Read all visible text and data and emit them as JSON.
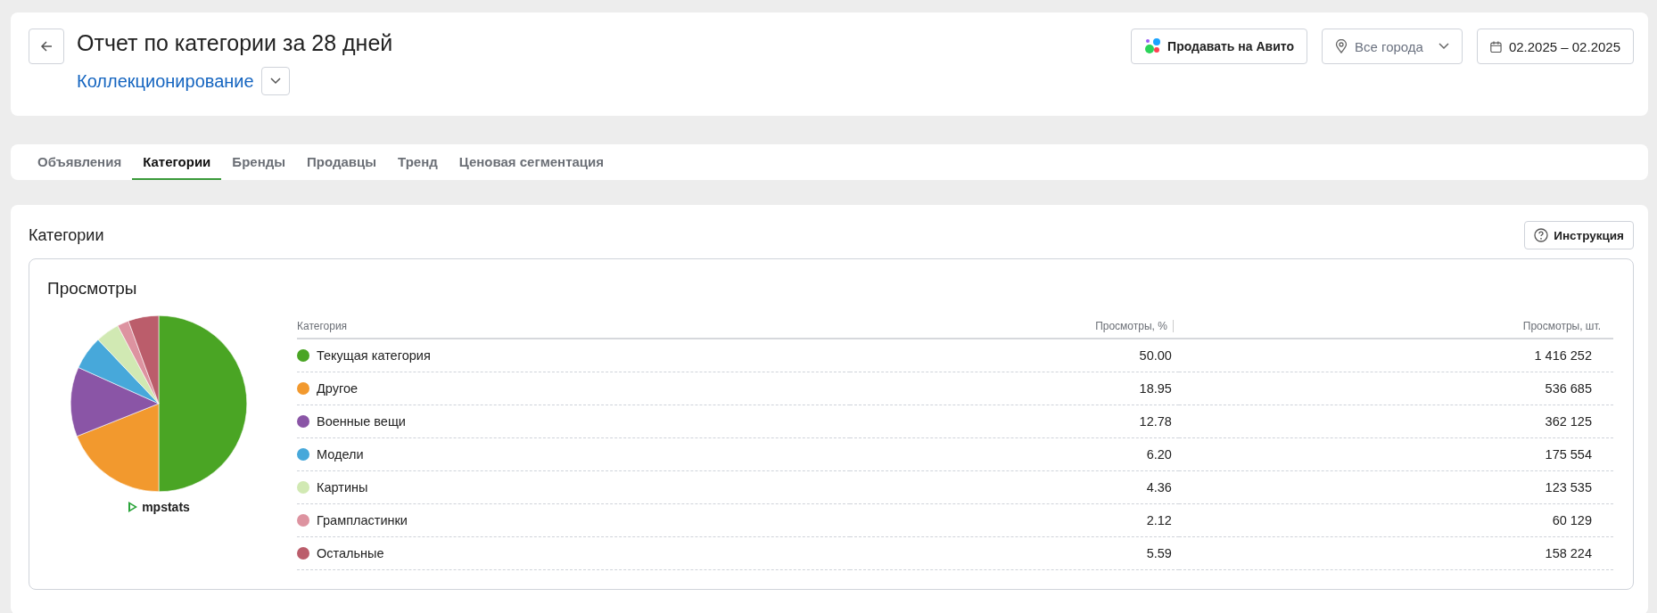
{
  "header": {
    "title": "Отчет по категории за 28 дней",
    "category": "Коллекционирование",
    "sell_button": "Продавать на Авито",
    "city_select": {
      "value": "Все города"
    },
    "date_range": "02.2025 – 02.2025"
  },
  "tabs": [
    {
      "label": "Объявления",
      "selected": false
    },
    {
      "label": "Категории",
      "selected": true
    },
    {
      "label": "Бренды",
      "selected": false
    },
    {
      "label": "Продавцы",
      "selected": false
    },
    {
      "label": "Тренд",
      "selected": false
    },
    {
      "label": "Ценовая сегментация",
      "selected": false
    }
  ],
  "section": {
    "title": "Категории",
    "help_button": "Инструкция"
  },
  "panel": {
    "chart_data": {
      "type": "pie",
      "title": "Просмотры",
      "series": [
        {
          "values": [
            50.0,
            18.95,
            12.78,
            6.2,
            4.36,
            2.12,
            5.59
          ]
        }
      ]
    },
    "watermark_logo": "mpstats",
    "table": {
      "columns": [
        "Категория",
        "Просмотры, %",
        "Просмотры, шт."
      ],
      "rows": [
        {
          "category": "Текущая категория",
          "color": "#4aa524",
          "percent": "50.00",
          "count": "1 416 252"
        },
        {
          "category": "Другое",
          "color": "#f2992e",
          "percent": "18.95",
          "count": "536 685"
        },
        {
          "category": "Военные вещи",
          "color": "#8a55a6",
          "percent": "12.78",
          "count": "362 125"
        },
        {
          "category": "Модели",
          "color": "#47a8da",
          "percent": "6.20",
          "count": "175 554"
        },
        {
          "category": "Картины",
          "color": "#d1e9b3",
          "percent": "4.36",
          "count": "123 535"
        },
        {
          "category": "Грампластинки",
          "color": "#dd93a0",
          "percent": "2.12",
          "count": "60 129"
        },
        {
          "category": "Остальные",
          "color": "#bb5d6b",
          "percent": "5.59",
          "count": "158 224"
        }
      ]
    }
  }
}
